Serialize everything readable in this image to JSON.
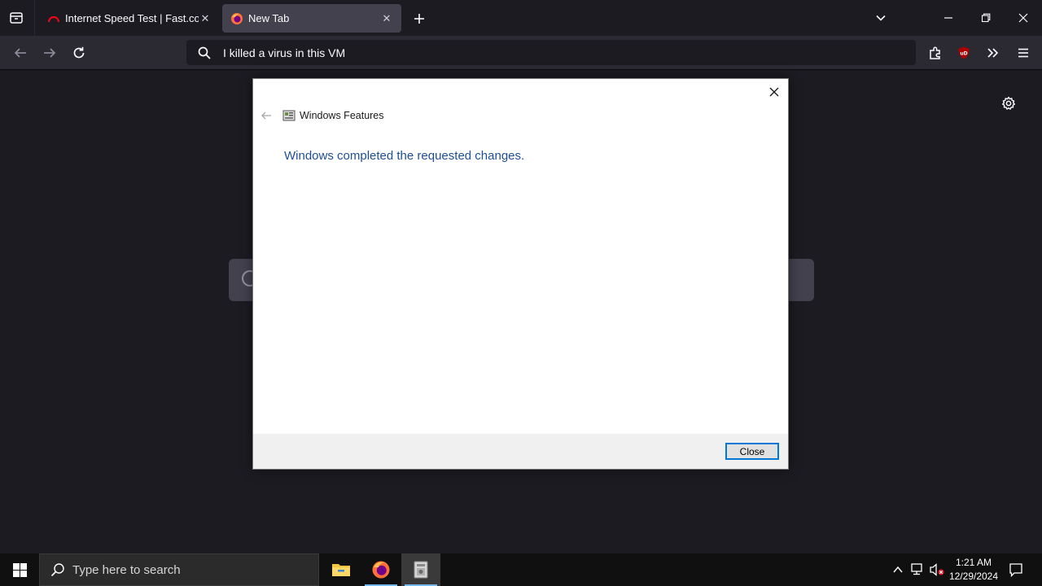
{
  "browser": {
    "tabs": [
      {
        "label": "Internet Speed Test | Fast.com",
        "favicon": "fast-speed-icon",
        "active": false
      },
      {
        "label": "New Tab",
        "favicon": "firefox-icon",
        "active": true
      }
    ],
    "close_tab_glyph": "✕",
    "url_bar": {
      "value": "I killed a virus in this VM",
      "placeholder": "I killed a virus in this VM"
    },
    "extension_badge": "uD"
  },
  "dialog": {
    "title": "Windows Features",
    "message": "Windows completed the requested changes.",
    "close_button_label": "Close",
    "close_glyph": "✕"
  },
  "taskbar": {
    "search_placeholder": "Type here to search",
    "apps": [
      "file-explorer-icon",
      "firefox-icon",
      "windows-features-icon"
    ],
    "clock": {
      "time": "1:21 AM",
      "date": "12/29/2024"
    }
  },
  "colors": {
    "browser_bg": "#1c1b22",
    "toolbar_bg": "#2b2a33",
    "dialog_message": "#1e4f96",
    "focus_accent": "#0078d7",
    "taskbar_bg": "#101010"
  }
}
